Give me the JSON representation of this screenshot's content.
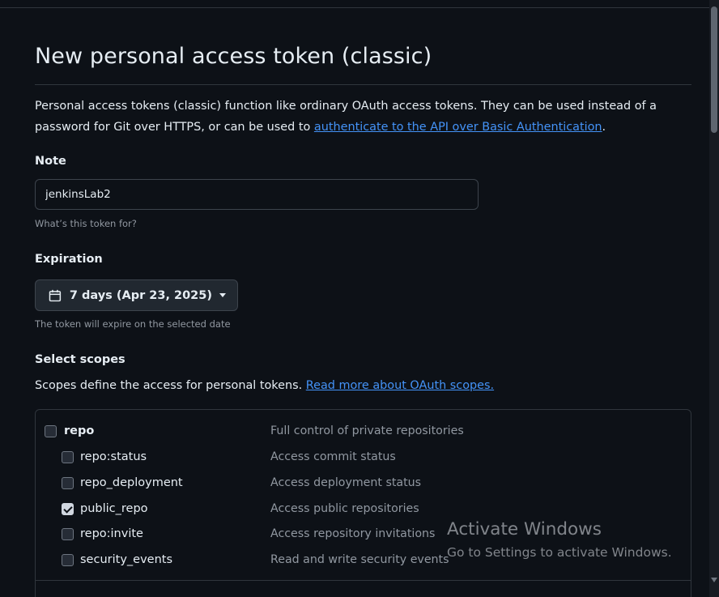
{
  "page": {
    "title": "New personal access token (classic)",
    "intro_text": "Personal access tokens (classic) function like ordinary OAuth access tokens. They can be used instead of a password for Git over HTTPS, or can be used to ",
    "intro_link": "authenticate to the API over Basic Authentication",
    "intro_end": "."
  },
  "note": {
    "label": "Note",
    "value": "jenkinsLab2",
    "hint": "What’s this token for?"
  },
  "expiration": {
    "label": "Expiration",
    "selected": "7 days (Apr 23, 2025)",
    "hint": "The token will expire on the selected date"
  },
  "scopes": {
    "label": "Select scopes",
    "description": "Scopes define the access for personal tokens. ",
    "link": "Read more about OAuth scopes.",
    "items": [
      {
        "name": "repo",
        "description": "Full control of private repositories",
        "checked": false
      },
      {
        "name": "repo:status",
        "description": "Access commit status",
        "checked": false
      },
      {
        "name": "repo_deployment",
        "description": "Access deployment status",
        "checked": false
      },
      {
        "name": "public_repo",
        "description": "Access public repositories",
        "checked": true
      },
      {
        "name": "repo:invite",
        "description": "Access repository invitations",
        "checked": false
      },
      {
        "name": "security_events",
        "description": "Read and write security events",
        "checked": false
      }
    ]
  },
  "watermark": {
    "line1": "Activate Windows",
    "line2": "Go to Settings to activate Windows."
  },
  "icons": {
    "expiration": "calendar-icon",
    "dropdown": "triangle-down-icon"
  },
  "colors": {
    "background": "#0d1117",
    "link": "#4493f8",
    "border": "#30363d",
    "muted_text": "#9198a1"
  }
}
